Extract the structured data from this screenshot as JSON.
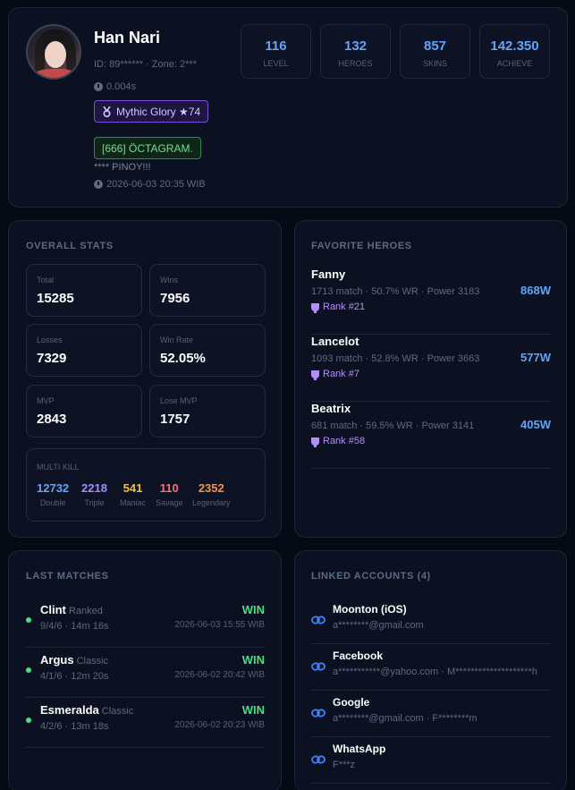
{
  "profile": {
    "name": "Han Nari",
    "id_zone": "ID: 89****** · Zone: 2***",
    "load_time": "0.004s",
    "rank_badge": "Mythic Glory ★74",
    "guild_badge": "[666] ÖCTAGRAM.",
    "bio": "**** PINOY!!!",
    "updated": "2026-06-03 20:35 WIB",
    "stats": [
      {
        "value": "116",
        "label": "LEVEL"
      },
      {
        "value": "132",
        "label": "HEROES"
      },
      {
        "value": "857",
        "label": "SKINS"
      },
      {
        "value": "142.350",
        "label": "ACHIEVE"
      }
    ]
  },
  "overall": {
    "title": "OVERALL STATS",
    "boxes": [
      {
        "label": "Total",
        "value": "15285"
      },
      {
        "label": "Wins",
        "value": "7956"
      },
      {
        "label": "Losses",
        "value": "7329"
      },
      {
        "label": "Win Rate",
        "value": "52.05%"
      },
      {
        "label": "MVP",
        "value": "2843"
      },
      {
        "label": "Lose MVP",
        "value": "1757"
      }
    ],
    "multikill": {
      "title": "MULTI KILL",
      "items": [
        {
          "value": "12732",
          "label": "Double",
          "color": "#60a5fa"
        },
        {
          "value": "2218",
          "label": "Triple",
          "color": "#a78bfa"
        },
        {
          "value": "541",
          "label": "Maniac",
          "color": "#fbbf24"
        },
        {
          "value": "110",
          "label": "Savage",
          "color": "#f87171"
        },
        {
          "value": "2352",
          "label": "Legendary",
          "color": "#fb923c"
        }
      ]
    }
  },
  "heroes": {
    "title": "FAVORITE HEROES",
    "items": [
      {
        "name": "Fanny",
        "info": "1713 match · 50.7% WR · Power 3183",
        "rank": "Rank #21",
        "power": "868W"
      },
      {
        "name": "Lancelot",
        "info": "1093 match · 52.8% WR · Power 3663",
        "rank": "Rank #7",
        "power": "577W"
      },
      {
        "name": "Beatrix",
        "info": "681 match · 59.5% WR · Power 3141",
        "rank": "Rank #58",
        "power": "405W"
      }
    ]
  },
  "matches": {
    "title": "LAST MATCHES",
    "items": [
      {
        "hero": "Clint",
        "mode": "Ranked",
        "kda": "9/4/6 · 14m 16s",
        "result": "WIN",
        "date": "2026-06-03 15:55 WIB"
      },
      {
        "hero": "Argus",
        "mode": "Classic",
        "kda": "4/1/6 · 12m 20s",
        "result": "WIN",
        "date": "2026-06-02 20:42 WIB"
      },
      {
        "hero": "Esmeralda",
        "mode": "Classic",
        "kda": "4/2/6 · 13m 18s",
        "result": "WIN",
        "date": "2026-06-02 20:23 WIB"
      }
    ]
  },
  "linked": {
    "title": "LINKED ACCOUNTS (4)",
    "items": [
      {
        "name": "Moonton (iOS)",
        "detail": "a********@gmail.com"
      },
      {
        "name": "Facebook",
        "detail": "a***********@yahoo.com · M********************h"
      },
      {
        "name": "Google",
        "detail": "a********@gmail.com · F********m"
      },
      {
        "name": "WhatsApp",
        "detail": "F***z"
      }
    ]
  },
  "colors": {
    "accent": "#60a5fa",
    "win": "#4ade80",
    "rank": "#b48dff"
  }
}
